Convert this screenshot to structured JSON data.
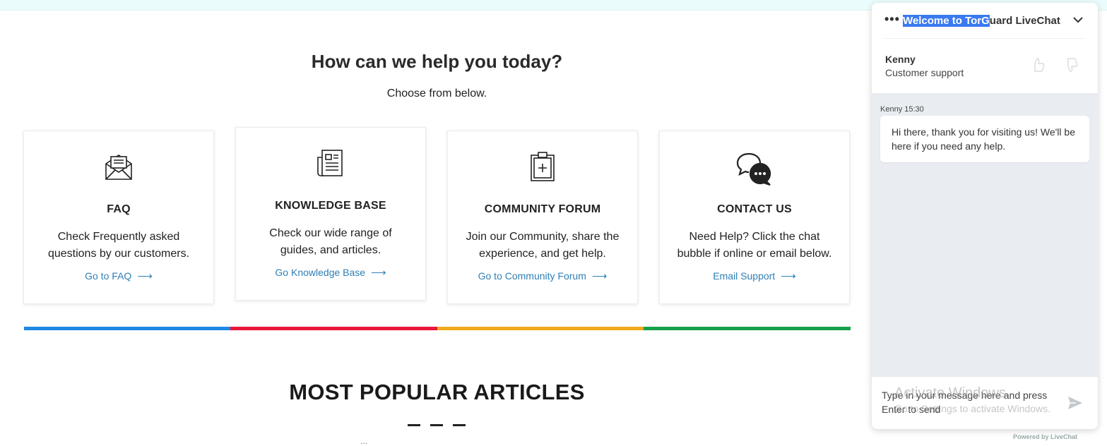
{
  "help": {
    "title": "How can we help you today?",
    "subtitle": "Choose from below."
  },
  "cards": [
    {
      "title": "FAQ",
      "desc": "Check Frequently asked questions by our customers.",
      "link": "Go to FAQ",
      "icon": "envelope-icon"
    },
    {
      "title": "KNOWLEDGE BASE",
      "desc": "Check our wide range of guides, and articles.",
      "link": "Go Knowledge Base",
      "icon": "newspaper-icon"
    },
    {
      "title": "COMMUNITY FORUM",
      "desc": "Join our Community, share the experience, and get help.",
      "link": "Go to Community Forum",
      "icon": "clipboard-icon"
    },
    {
      "title": "CONTACT US",
      "desc": "Need Help? Click the chat bubble if online or email below.",
      "link": "Email Support",
      "icon": "chat-bubbles-icon"
    }
  ],
  "colors": {
    "accent_link": "#2f7fb5",
    "bar_blue": "#1e88e5",
    "bar_red": "#e8173a",
    "bar_yellow": "#f0a91d",
    "bar_green": "#17a04a"
  },
  "popular": {
    "title": "MOST POPULAR ARTICLES",
    "ghost_text": "..."
  },
  "chat": {
    "title_selected": "Welcome to TorG",
    "title_rest": "uard LiveChat",
    "menu_label": "•••",
    "agent_name": "Kenny",
    "agent_role": "Customer support",
    "message_meta": "Kenny 15:30",
    "message_text": "Hi there, thank you for visiting us! We'll be here if you need any help.",
    "input_placeholder": "Type in your message here and press Enter to send",
    "powered_by": "Powered by LiveChat"
  },
  "watermark": {
    "line1": "Activate Windows",
    "line2": "Go to Settings to activate Windows."
  }
}
